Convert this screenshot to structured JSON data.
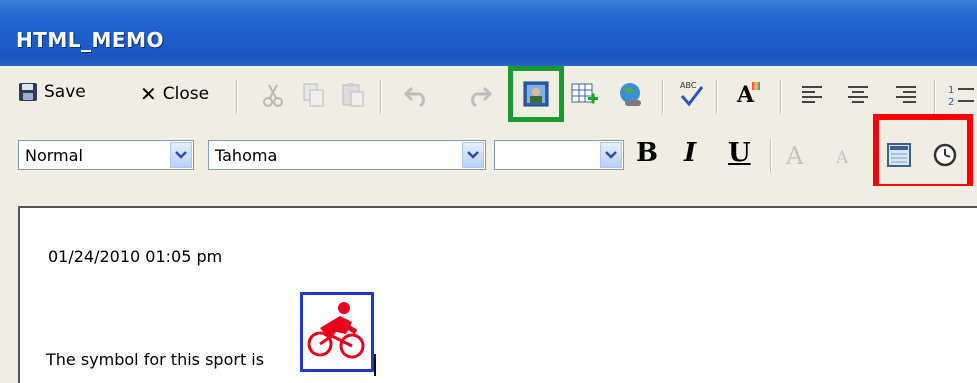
{
  "window": {
    "title": "HTML_MEMO"
  },
  "toolbar1": {
    "save_label": "Save",
    "close_label": "Close",
    "buttons": [
      "cut-icon",
      "copy-icon",
      "paste-icon",
      "undo-icon",
      "redo-icon",
      "insert-image-icon",
      "insert-table-icon",
      "insert-link-icon",
      "spellcheck-icon",
      "font-color-icon",
      "align-left-icon",
      "align-center-icon",
      "align-right-icon",
      "numbered-list-icon"
    ]
  },
  "toolbar2": {
    "style_value": "Normal",
    "font_value": "Tahoma",
    "size_value": "",
    "bold": "B",
    "italic": "I",
    "underline": "U",
    "grow_font": "A",
    "shrink_font": "A"
  },
  "editor": {
    "timestamp": "01/24/2010 01:05 pm",
    "line2": "The symbol for this sport is"
  },
  "colors": {
    "title_bg": "#1f5fca",
    "green_highlight": "#1a9a32",
    "red_highlight": "#ff0000",
    "sport_icon": "#e8001c",
    "icon_frame": "#1f3bc4"
  }
}
